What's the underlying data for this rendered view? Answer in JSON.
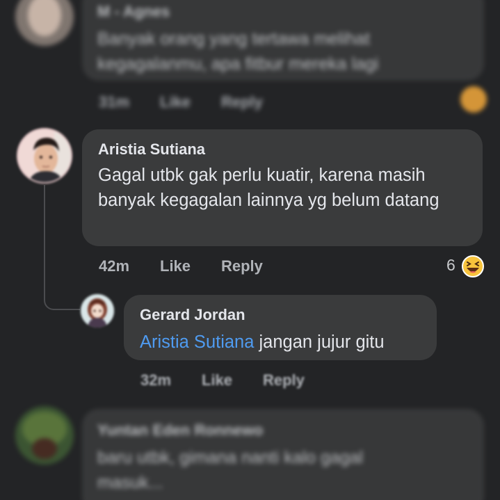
{
  "comments": {
    "top": {
      "name": "M - Agnes",
      "text": "Banyak orang yang tertawa melihat kegagalanmu, apa fitbur mereka lagi",
      "time": "31m",
      "like": "Like",
      "reply": "Reply"
    },
    "main": {
      "name": "Aristia Sutiana",
      "text": "Gagal utbk gak perlu kuatir, karena masih banyak kegagalan lainnya yg belum datang",
      "time": "42m",
      "like": "Like",
      "reply": "Reply",
      "reaction_count": "6",
      "reaction_icon": "laughing-emoji-icon"
    },
    "reply": {
      "name": "Gerard Jordan",
      "mention": "Aristia Sutiana",
      "text": "jangan jujur gitu",
      "time": "32m",
      "like": "Like",
      "reply": "Reply"
    },
    "bottom": {
      "name": "Yuntan Eden Ronnewo",
      "text": "baru utbk, gimana nanti kalo gagal masuk..."
    }
  },
  "colors": {
    "background": "#232426",
    "bubble": "#3a3b3c",
    "mention": "#4f9bf0",
    "meta_text": "#b0b3b8",
    "emoji": "#f5c33b"
  }
}
